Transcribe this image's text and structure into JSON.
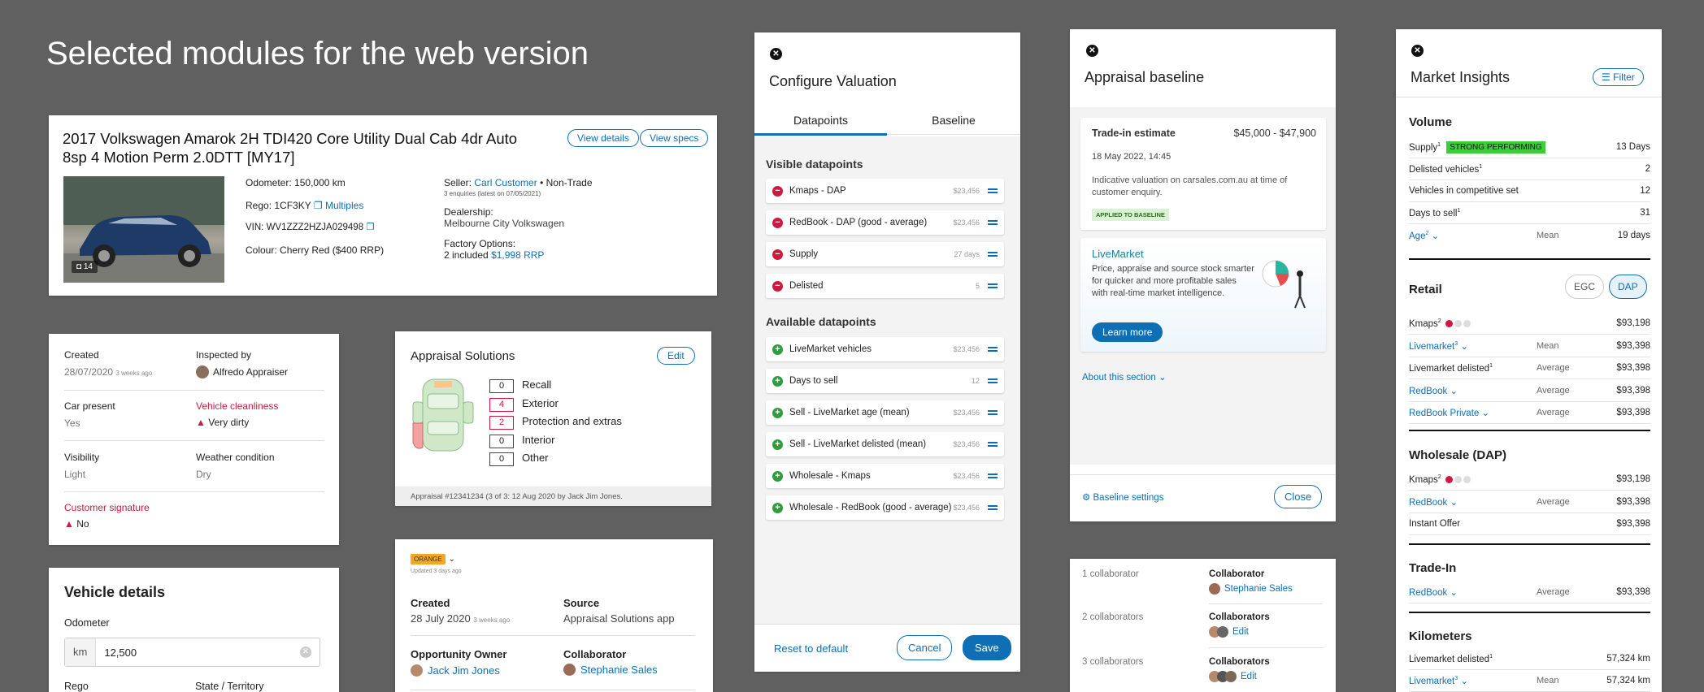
{
  "page_title": "Selected modules for the web version",
  "vehicle_summary": {
    "title": "2017 Volkswagen Amarok 2H TDI420 Core Utility Dual Cab 4dr Auto 8sp 4 Motion Perm 2.0DTT [MY17]",
    "view_details": "View details",
    "view_specs": "View specs",
    "photo_count": "14",
    "odometer_label": "Odometer:",
    "odometer": "150,000 km",
    "rego_label": "Rego:",
    "rego": "1CF3KY",
    "rego_link": "Multiples",
    "vin_label": "VIN:",
    "vin": "WV1ZZZ2HZJA029498",
    "colour_label": "Colour:",
    "colour": "Cherry Red ($400 RRP)",
    "seller_label": "Seller:",
    "seller": "Carl Customer",
    "seller_type": "• Non-Trade",
    "enquiries": "3 enquiries (latest on 07/05/2021)",
    "dealership_label": "Dealership:",
    "dealership": "Melbourne City Volkswagen",
    "factory_label": "Factory Options:",
    "factory_count": "2 included",
    "factory_price": "$1,998 RRP"
  },
  "inspection": {
    "created_label": "Created",
    "created": "28/07/2020",
    "created_ago": "3 weeks ago",
    "inspected_label": "Inspected by",
    "inspector": "Alfredo Appraiser",
    "car_present_label": "Car present",
    "car_present": "Yes",
    "cleanliness_label": "Vehicle cleanliness",
    "cleanliness": "Very dirty",
    "visibility_label": "Visibility",
    "visibility": "Light",
    "weather_label": "Weather condition",
    "weather": "Dry",
    "signature_label": "Customer signature",
    "signature": "No"
  },
  "vehicle_details": {
    "title": "Vehicle details",
    "odometer_label": "Odometer",
    "unit": "km",
    "odometer_value": "12,500",
    "rego_label": "Rego",
    "state_label": "State / Territory"
  },
  "appraisal_solutions": {
    "title": "Appraisal Solutions",
    "edit": "Edit",
    "items": [
      {
        "count": "0",
        "label": "Recall",
        "red": false
      },
      {
        "count": "4",
        "label": "Exterior",
        "red": true
      },
      {
        "count": "2",
        "label": "Protection and extras",
        "red": true
      },
      {
        "count": "0",
        "label": "Interior",
        "red": false
      },
      {
        "count": "0",
        "label": "Other",
        "red": false
      }
    ],
    "footer": "Appraisal #12341234 (3 of 3: 12 Aug 2020 by Jack Jim Jones."
  },
  "opportunity": {
    "badge": "ORANGE",
    "updated": "Updated 3 days ago",
    "created_label": "Created",
    "created": "28 July 2020",
    "created_ago": "3 weeks ago",
    "source_label": "Source",
    "source": "Appraisal Solutions app",
    "owner_label": "Opportunity Owner",
    "owner": "Jack Jim Jones",
    "collab_label": "Collaborator",
    "collab": "Stephanie Sales"
  },
  "configure_valuation": {
    "title": "Configure Valuation",
    "tabs": [
      "Datapoints",
      "Baseline"
    ],
    "visible_title": "Visible datapoints",
    "visible": [
      {
        "label": "Kmaps - DAP",
        "value": "$23,456"
      },
      {
        "label": "RedBook - DAP (good - average)",
        "value": "$23,456"
      },
      {
        "label": "Supply",
        "value": "27 days"
      },
      {
        "label": "Delisted",
        "value": "5"
      }
    ],
    "available_title": "Available datapoints",
    "available": [
      {
        "label": "LiveMarket vehicles",
        "value": "$23,456"
      },
      {
        "label": "Days to sell",
        "value": "12"
      },
      {
        "label": "Sell - LiveMarket age (mean)",
        "value": "$23,456"
      },
      {
        "label": "Sell - LiveMarket delisted (mean)",
        "value": "$23,456"
      },
      {
        "label": "Wholesale - Kmaps",
        "value": "$23,456"
      },
      {
        "label": "Wholesale - RedBook (good - average)",
        "value": "$23,456"
      }
    ],
    "reset": "Reset to default",
    "cancel": "Cancel",
    "save": "Save"
  },
  "appraisal_baseline": {
    "title": "Appraisal baseline",
    "trade_label": "Trade-in estimate",
    "trade_range": "$45,000 - $47,900",
    "date": "18 May 2022, 14:45",
    "desc": "Indicative valuation on carsales.com.au at time of customer enquiry.",
    "applied": "APPLIED TO BASELINE",
    "lm_title": "LiveMarket",
    "lm_desc": "Price, appraise and source stock smarter for quicker and more profitable sales with real-time market intelligence.",
    "learn_more": "Learn more",
    "about": "About this section",
    "settings": "Baseline settings",
    "close": "Close"
  },
  "collaborators": [
    {
      "count": "1 collaborator",
      "label": "Collaborator",
      "name": "Stephanie Sales",
      "link": true
    },
    {
      "count": "2 collaborators",
      "label": "Collaborators",
      "name": "Edit",
      "link": true
    },
    {
      "count": "3 collaborators",
      "label": "Collaborators",
      "name": "Edit",
      "link": true
    }
  ],
  "market_insights": {
    "title": "Market Insights",
    "filter": "Filter",
    "volume_title": "Volume",
    "supply_label": "Supply",
    "supply_badge": "STRONG PERFORMING",
    "supply_value": "13 Days",
    "volume_rows": [
      {
        "label": "Delisted vehicles",
        "sup": "1",
        "value": "2"
      },
      {
        "label": "Vehicles in competitive set",
        "sup": "",
        "value": "12"
      },
      {
        "label": "Days to sell",
        "sup": "1",
        "value": "31"
      }
    ],
    "age_label": "Age",
    "age_sup": "2",
    "age_mode": "Mean",
    "age_value": "19 days",
    "retail_title": "Retail",
    "egc": "EGC",
    "dap": "DAP",
    "retail_rows": [
      {
        "label": "Kmaps",
        "sup": "2",
        "mode": "",
        "value": "$93,198",
        "link": false,
        "dots": true
      },
      {
        "label": "Livemarket",
        "sup": "3",
        "mode": "Mean",
        "value": "$93,398",
        "link": true,
        "dots": false
      },
      {
        "label": "Livemarket delisted",
        "sup": "1",
        "mode": "Average",
        "value": "$93,398",
        "link": false,
        "dots": false
      },
      {
        "label": "RedBook",
        "sup": "",
        "mode": "Average",
        "value": "$93,398",
        "link": true,
        "dots": false
      },
      {
        "label": "RedBook Private",
        "sup": "",
        "mode": "Average",
        "value": "$93,398",
        "link": true,
        "dots": false
      }
    ],
    "wholesale_title": "Wholesale (DAP)",
    "wholesale_rows": [
      {
        "label": "Kmaps",
        "sup": "2",
        "mode": "",
        "value": "$93,198",
        "link": false,
        "dots": true
      },
      {
        "label": "RedBook",
        "sup": "",
        "mode": "Average",
        "value": "$93,398",
        "link": true,
        "dots": false
      },
      {
        "label": "Instant Offer",
        "sup": "",
        "mode": "",
        "value": "$93,398",
        "link": false,
        "dots": false
      }
    ],
    "tradein_title": "Trade-In",
    "tradein_rows": [
      {
        "label": "RedBook",
        "sup": "",
        "mode": "Average",
        "value": "$93,398",
        "link": true,
        "dots": false
      }
    ],
    "km_title": "Kilometers",
    "km_rows": [
      {
        "label": "Livemarket delisted",
        "sup": "1",
        "mode": "",
        "value": "57,324 km",
        "link": false,
        "dots": false
      },
      {
        "label": "Livemarket",
        "sup": "3",
        "mode": "Mean",
        "value": "57,324 km",
        "link": true,
        "dots": false
      }
    ]
  },
  "colors": {
    "accent": "#0f6fb5",
    "alert": "#cc1a3f",
    "success": "#2ecc40",
    "background": "#606060"
  }
}
